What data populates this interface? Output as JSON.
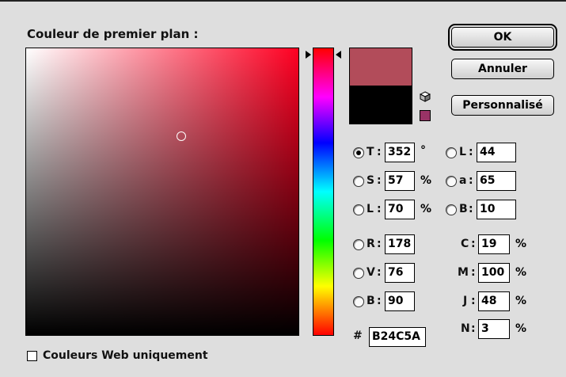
{
  "title": "Couleur de premier plan :",
  "buttons": {
    "ok": "OK",
    "cancel": "Annuler",
    "custom": "Personnalisé"
  },
  "colors": {
    "current": "#b24c5a",
    "previous": "#000000",
    "websafe_swatch": "#993366"
  },
  "picker": {
    "mode": "hue",
    "hue": 352,
    "selected_saturation": 57,
    "selected_lightness": 70
  },
  "hsl": [
    {
      "label": "T",
      "value": "352",
      "unit": "°",
      "selected": true
    },
    {
      "label": "S",
      "value": "57",
      "unit": "%",
      "selected": false
    },
    {
      "label": "L",
      "value": "70",
      "unit": "%",
      "selected": false
    }
  ],
  "rgb": [
    {
      "label": "R",
      "value": "178"
    },
    {
      "label": "V",
      "value": "76"
    },
    {
      "label": "B",
      "value": "90"
    }
  ],
  "lab": [
    {
      "label": "L",
      "value": "44"
    },
    {
      "label": "a",
      "value": "65"
    },
    {
      "label": "B",
      "value": "10"
    }
  ],
  "cmyk": [
    {
      "label": "C",
      "value": "19",
      "unit": "%"
    },
    {
      "label": "M",
      "value": "100",
      "unit": "%"
    },
    {
      "label": "J",
      "value": "48",
      "unit": "%"
    },
    {
      "label": "N",
      "value": "3",
      "unit": "%"
    }
  ],
  "hex": {
    "prefix": "#",
    "value": "B24C5A"
  },
  "web_only": {
    "label": "Couleurs Web uniquement",
    "checked": false
  },
  "icons": {
    "gamut_warning": "cube-icon"
  }
}
